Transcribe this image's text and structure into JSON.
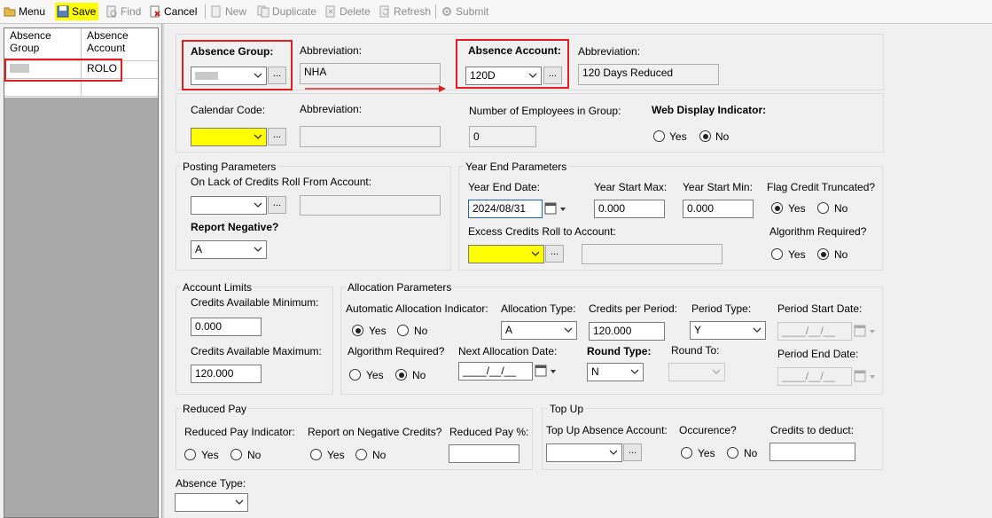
{
  "toolbar": {
    "menu": "Menu",
    "save": "Save",
    "find": "Find",
    "cancel": "Cancel",
    "new": "New",
    "duplicate": "Duplicate",
    "delete": "Delete",
    "refresh": "Refresh",
    "submit": "Submit"
  },
  "list": {
    "col1_line1": "Absence",
    "col1_line2": "Group",
    "col2_line1": "Absence",
    "col2_line2": "Account",
    "row1_col2": "ROLO"
  },
  "header": {
    "absence_group_label": "Absence Group:",
    "abbrev_label": "Abbreviation:",
    "group_abbrev_value": "NHA",
    "absence_account_label": "Absence Account:",
    "absence_account_value": "120D",
    "account_abbrev_value": "120 Days Reduced",
    "ellipsis": "..."
  },
  "calendar": {
    "label": "Calendar Code:",
    "abbrev_label": "Abbreviation:",
    "num_employees_label": "Number of Employees in Group:",
    "num_employees_value": "0",
    "web_display_label": "Web Display Indicator:",
    "yes": "Yes",
    "no": "No"
  },
  "posting": {
    "legend": "Posting Parameters",
    "lack_label": "On Lack of Credits Roll From Account:",
    "report_negative_label": "Report Negative?",
    "report_negative_value": "A"
  },
  "year_end": {
    "legend": "Year End Parameters",
    "date_label": "Year End Date:",
    "date_value": "2024/08/31",
    "start_max_label": "Year Start Max:",
    "start_max_value": "0.000",
    "start_min_label": "Year Start Min:",
    "start_min_value": "0.000",
    "flag_label": "Flag Credit Truncated?",
    "excess_label": "Excess Credits Roll to Account:",
    "algo_label": "Algorithm Required?",
    "yes": "Yes",
    "no": "No"
  },
  "limits": {
    "legend": "Account Limits",
    "min_label": "Credits Available Minimum:",
    "min_value": "0.000",
    "max_label": "Credits Available Maximum:",
    "max_value": "120.000"
  },
  "allocation": {
    "legend": "Allocation Parameters",
    "auto_label": "Automatic Allocation Indicator:",
    "type_label": "Allocation Type:",
    "type_value": "A",
    "credits_label": "Credits per Period:",
    "credits_value": "120.000",
    "period_type_label": "Period Type:",
    "period_type_value": "Y",
    "start_date_label": "Period Start Date:",
    "algo_label": "Algorithm Required?",
    "next_date_label": "Next Allocation Date:",
    "round_type_label": "Round Type:",
    "round_type_value": "N",
    "round_to_label": "Round To:",
    "end_date_label": "Period End Date:",
    "empty_date": "____/__/__",
    "yes": "Yes",
    "no": "No"
  },
  "reduced": {
    "legend": "Reduced Pay",
    "indicator_label": "Reduced Pay Indicator:",
    "report_label": "Report on Negative Credits?",
    "percent_label": "Reduced Pay %:",
    "yes": "Yes",
    "no": "No"
  },
  "topup": {
    "legend": "Top Up",
    "account_label": "Top Up Absence Account:",
    "occurence_label": "Occurence?",
    "credits_label": "Credits to deduct:",
    "yes": "Yes",
    "no": "No"
  },
  "absence_type": {
    "label": "Absence Type:"
  },
  "colors": {
    "highlight": "#ffff00",
    "annotation": "#e02020"
  }
}
